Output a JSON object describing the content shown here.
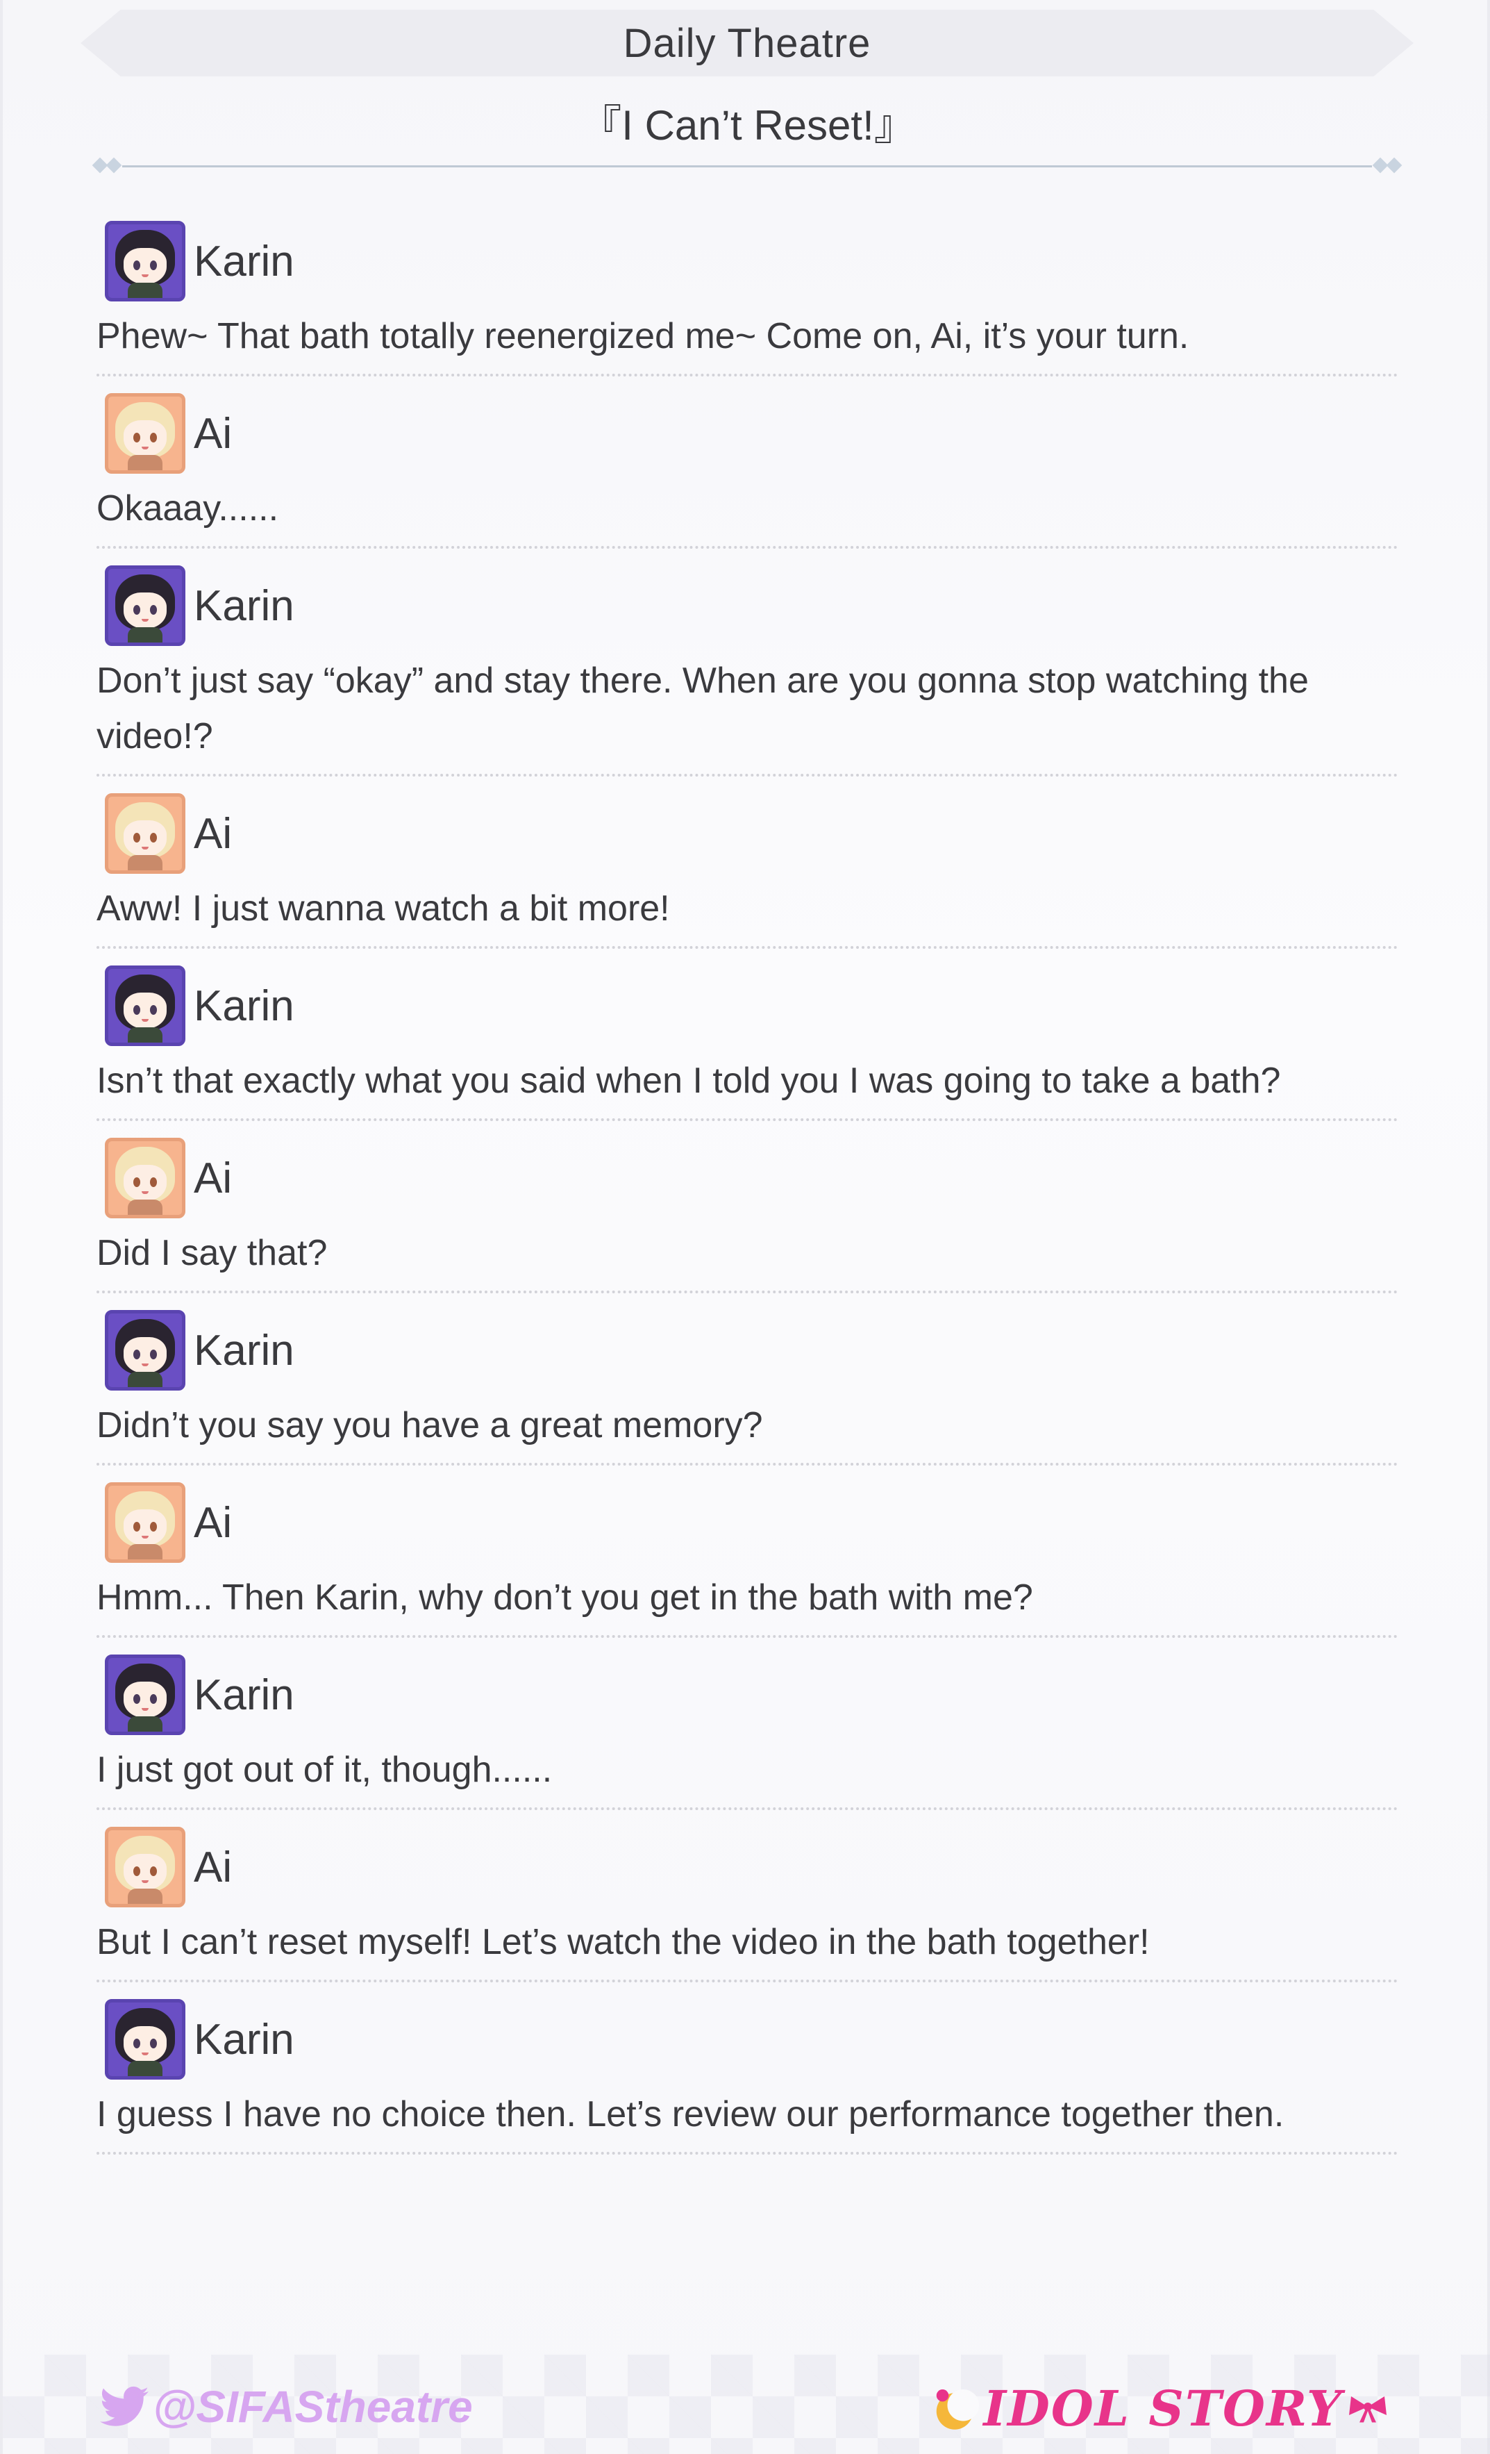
{
  "header": {
    "section": "Daily Theatre",
    "title": "『I Can’t Reset!』"
  },
  "dialogue": [
    {
      "speaker": "Karin",
      "avatar": "karin-avatar-icon",
      "text": "Phew~ That bath totally reenergized me~ Come on, Ai, it’s your turn."
    },
    {
      "speaker": "Ai",
      "avatar": "ai-avatar-icon",
      "text": "Okaaay......"
    },
    {
      "speaker": "Karin",
      "avatar": "karin-avatar-icon",
      "text": "Don’t just say “okay” and stay there. When are you gonna stop watching the video!?"
    },
    {
      "speaker": "Ai",
      "avatar": "ai-avatar-icon",
      "text": "Aww! I just wanna watch a bit more!"
    },
    {
      "speaker": "Karin",
      "avatar": "karin-avatar-icon",
      "text": "Isn’t that exactly what you said when I told you I was going to take a bath?"
    },
    {
      "speaker": "Ai",
      "avatar": "ai-avatar-icon",
      "text": "Did I say that?"
    },
    {
      "speaker": "Karin",
      "avatar": "karin-avatar-icon",
      "text": "Didn’t you say you have a great memory?"
    },
    {
      "speaker": "Ai",
      "avatar": "ai-avatar-icon",
      "text": "Hmm... Then Karin, why don’t you get in the bath with me?"
    },
    {
      "speaker": "Karin",
      "avatar": "karin-avatar-icon",
      "text": "I just got out of it, though......"
    },
    {
      "speaker": "Ai",
      "avatar": "ai-avatar-icon",
      "text": "But I can’t reset myself! Let’s watch the video in the bath together!"
    },
    {
      "speaker": "Karin",
      "avatar": "karin-avatar-icon",
      "text": "I guess I have no choice then. Let’s review our performance together then."
    }
  ],
  "footer": {
    "handle": "@SIFAStheatre",
    "logo_text": "IDOL STORY"
  },
  "colors": {
    "karin_accent": "#6a4fc4",
    "ai_accent": "#f7b48e",
    "handle": "#d7a6f0",
    "logo": "#e8348a"
  }
}
